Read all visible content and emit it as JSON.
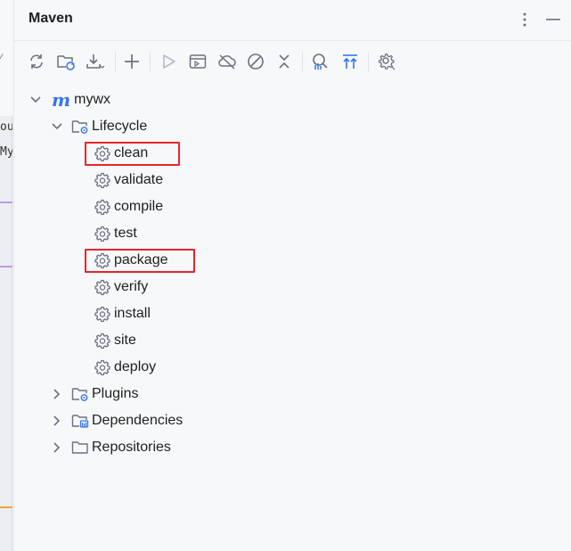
{
  "window": {
    "title": "Maven"
  },
  "header": {
    "more_icon": "more-vertical-icon",
    "minimize_icon": "minimize-icon"
  },
  "editor_fragment": {
    "line1": "ou",
    "line2": "My"
  },
  "toolbar": {
    "buttons": [
      {
        "name": "reload-all-projects",
        "icon": "refresh-icon"
      },
      {
        "name": "generate-sources",
        "icon": "folder-refresh-icon"
      },
      {
        "name": "download-sources",
        "icon": "download-icon"
      },
      {
        "name": "add-maven-projects",
        "icon": "plus-icon"
      },
      {
        "name": "run-maven-build",
        "icon": "play-icon"
      },
      {
        "name": "execute-maven-goal",
        "icon": "terminal-window-icon"
      },
      {
        "name": "toggle-offline-mode",
        "icon": "cloud-off-icon"
      },
      {
        "name": "skip-tests",
        "icon": "no-entry-icon"
      },
      {
        "name": "collapse-all",
        "icon": "collapse-icon"
      },
      {
        "name": "analyze-dependencies",
        "icon": "analyze-icon"
      },
      {
        "name": "show-dependencies",
        "icon": "expand-up-icon"
      },
      {
        "name": "build-tool-settings",
        "icon": "gear-icon"
      }
    ]
  },
  "tree": {
    "project": {
      "label": "mywx",
      "icon": "maven-m-icon",
      "expanded": true
    },
    "lifecycle": {
      "label": "Lifecycle",
      "expanded": true,
      "goals": [
        {
          "label": "clean",
          "highlighted": true
        },
        {
          "label": "validate",
          "highlighted": false
        },
        {
          "label": "compile",
          "highlighted": false
        },
        {
          "label": "test",
          "highlighted": false
        },
        {
          "label": "package",
          "highlighted": true
        },
        {
          "label": "verify",
          "highlighted": false
        },
        {
          "label": "install",
          "highlighted": false
        },
        {
          "label": "site",
          "highlighted": false
        },
        {
          "label": "deploy",
          "highlighted": false
        }
      ]
    },
    "plugins": {
      "label": "Plugins",
      "expanded": false
    },
    "dependencies": {
      "label": "Dependencies",
      "expanded": false
    },
    "repositories": {
      "label": "Repositories",
      "expanded": false
    }
  },
  "colors": {
    "accent": "#3574f0",
    "highlight_box": "#e8252a",
    "icon_gray": "#6c707e",
    "background": "#f7f8fa"
  }
}
